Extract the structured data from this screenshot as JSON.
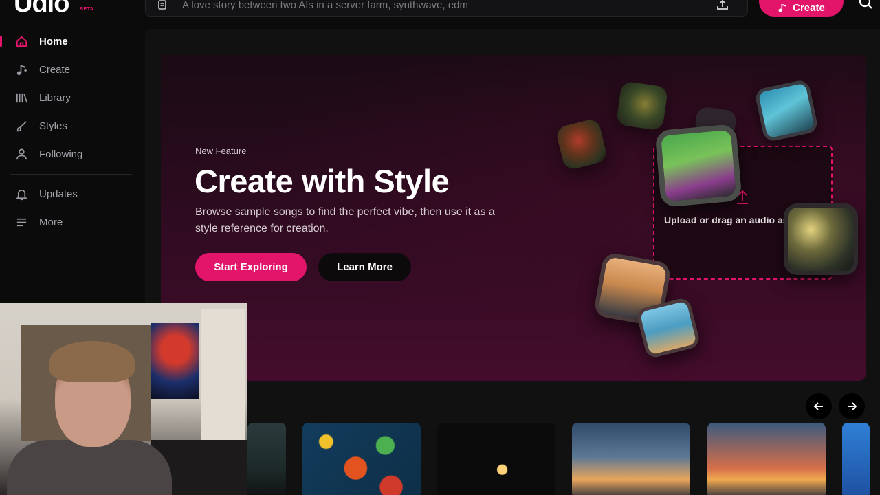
{
  "app": {
    "logo_text": "Udio",
    "beta_label": "BETA"
  },
  "search": {
    "placeholder": "A love story between two AIs in a server farm, synthwave, edm"
  },
  "topbar": {
    "create_label": "Create"
  },
  "sidebar": {
    "items": [
      {
        "label": "Home",
        "icon": "home-icon",
        "active": true
      },
      {
        "label": "Create",
        "icon": "music-note-icon"
      },
      {
        "label": "Library",
        "icon": "library-icon"
      },
      {
        "label": "Styles",
        "icon": "brush-icon"
      },
      {
        "label": "Following",
        "icon": "person-icon"
      },
      {
        "label": "Updates",
        "icon": "bell-icon"
      },
      {
        "label": "More",
        "icon": "menu-icon"
      }
    ]
  },
  "hero": {
    "tag": "New Feature",
    "title": "Create with Style",
    "description": "Browse sample songs to find the perfect vibe, then use it as a style reference for creation.",
    "primary_button": "Start Exploring",
    "secondary_button": "Learn More",
    "dropzone_text": "Upload or drag an audio as a style"
  },
  "carousel": {
    "prev_icon": "arrow-left-icon",
    "next_icon": "arrow-right-icon"
  },
  "colors": {
    "accent": "#e3156b",
    "background": "#0b0b0c",
    "hero_bg": "#2a0b1e"
  }
}
